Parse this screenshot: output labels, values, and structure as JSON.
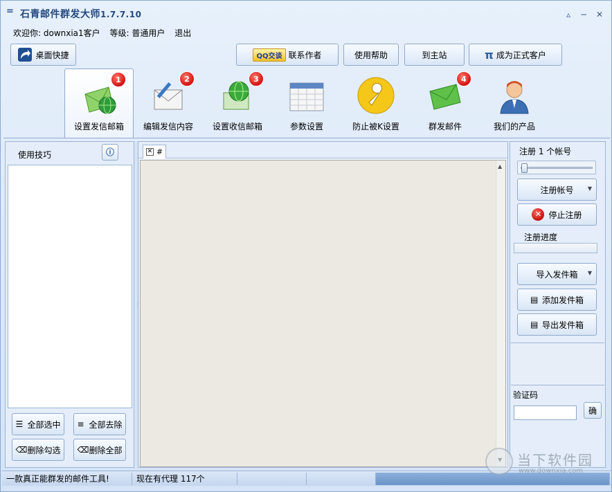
{
  "window": {
    "title": "石青邮件群发大师",
    "version": "1.7.7.10",
    "colors": {
      "frame": "#d6e4f5",
      "accent": "#23487f",
      "badge": "#d31010"
    }
  },
  "userbar": {
    "welcome": "欢迎你: downxia1客户",
    "level": "等级: 普通用户",
    "logout": "退出"
  },
  "toolbar": {
    "desktop_shortcut": "桌面快捷",
    "qq_badge": "QQ交谈",
    "contact_author": "联系作者",
    "help": "使用帮助",
    "home": "到主站",
    "pi_symbol": "π",
    "become_customer": "成为正式客户"
  },
  "tabs": [
    {
      "label": "设置发信邮箱",
      "badge": "1",
      "icon": "green-envelope-globe-icon"
    },
    {
      "label": "编辑发信内容",
      "badge": "2",
      "icon": "envelope-pen-icon"
    },
    {
      "label": "设置收信邮箱",
      "badge": "3",
      "icon": "mail-globe-icon"
    },
    {
      "label": "参数设置",
      "badge": "",
      "icon": "calendar-grid-icon"
    },
    {
      "label": "防止被K设置",
      "badge": "",
      "icon": "wrench-icon"
    },
    {
      "label": "群发邮件",
      "badge": "4",
      "icon": "green-envelope-icon"
    },
    {
      "label": "我们的产品",
      "badge": "",
      "icon": "user-avatar-icon"
    }
  ],
  "left": {
    "header": "使用技巧",
    "select_all": "全部选中",
    "clear_all": "全部去除",
    "delete_checked": "删除勾选",
    "delete_all": "删除全部"
  },
  "center": {
    "doc_tab": "#"
  },
  "right": {
    "register_count": "注册 1 个帐号",
    "slider_value": 0.0,
    "register_account": "注册帐号",
    "stop_register": "停止注册",
    "register_progress": "注册进度",
    "progress_value": 0.0,
    "import_outbox": "导入发件箱",
    "add_outbox": "添加发件箱",
    "export_outbox": "导出发件箱",
    "captcha_label": "验证码",
    "captcha_value": "",
    "confirm": "确"
  },
  "status": {
    "slogan": "一款真正能群发的邮件工具!",
    "proxy": "现在有代理 117个"
  },
  "watermark": {
    "text": "当下软件园",
    "url": "www.downxia.com"
  }
}
